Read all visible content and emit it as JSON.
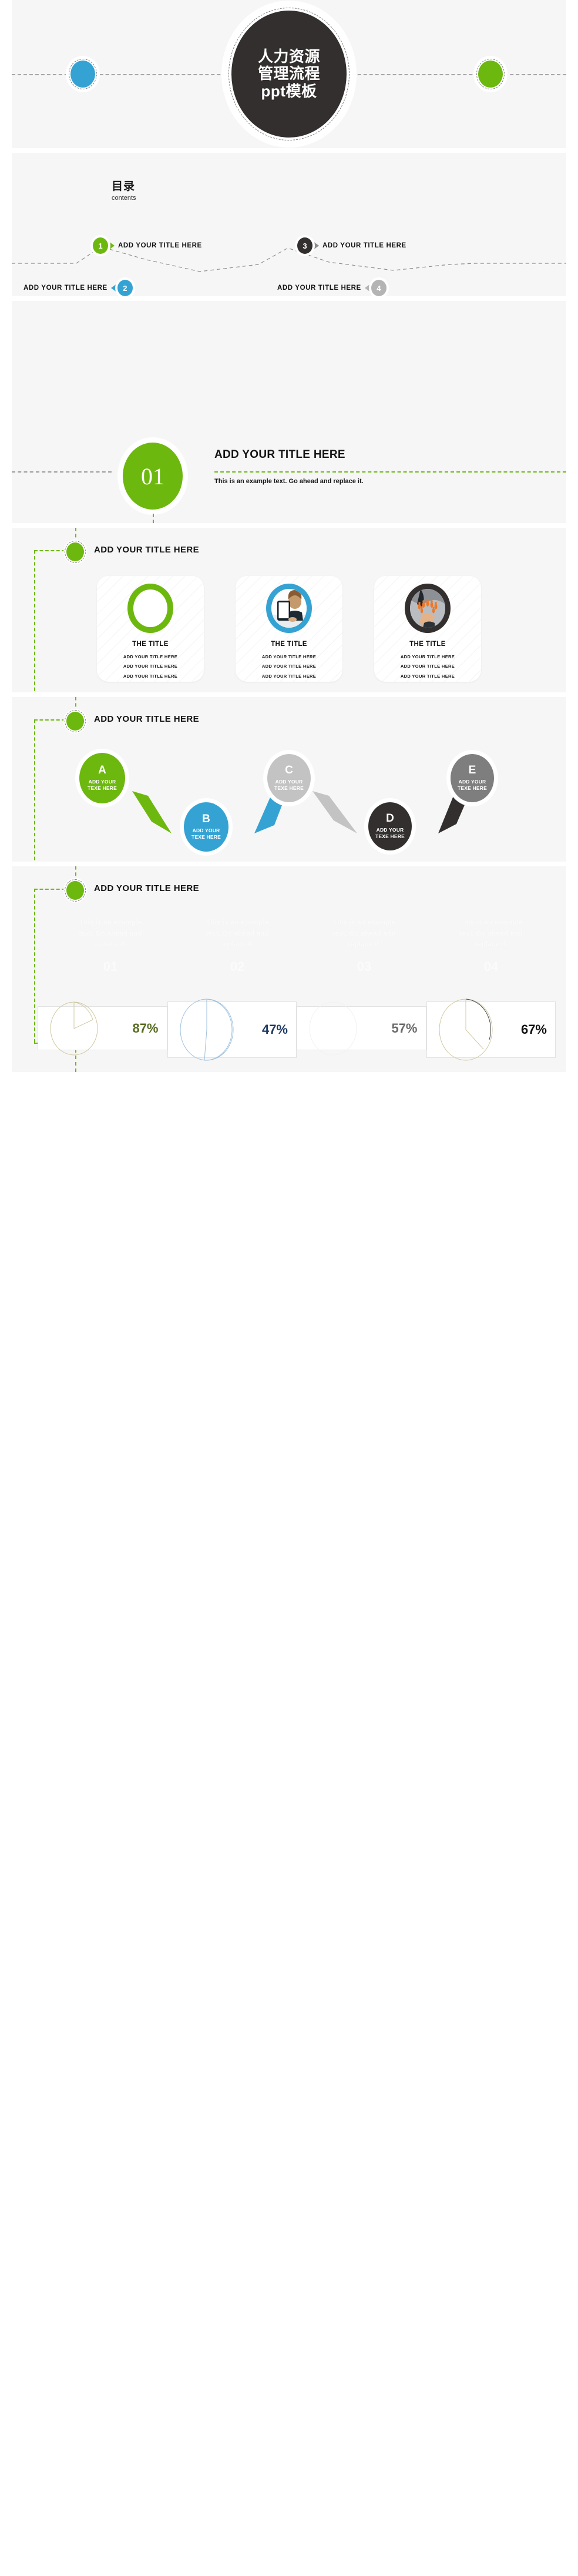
{
  "colors": {
    "green": "#6db80e",
    "blue": "#34a3d3",
    "dark": "#332f2e",
    "grey": "#c3c3c3",
    "grey_dark": "#7e7e7e",
    "page_bg": "#f6f6f6"
  },
  "slide1": {
    "name": "title-slide",
    "title_lines": [
      "人力资源",
      "管理流程",
      "ppt模板"
    ],
    "left_dot": "blue-dot",
    "right_dot": "green-dot"
  },
  "slide2": {
    "name": "contents-slide",
    "heading_cn": "目录",
    "heading_en": "contents",
    "items": [
      {
        "number": "1",
        "label": "ADD YOUR  TITLE HERE",
        "color": "#6db80e",
        "side": "right"
      },
      {
        "number": "2",
        "label": "ADD YOUR  TITLE HERE",
        "color": "#34a3d3",
        "side": "left"
      },
      {
        "number": "3",
        "label": "ADD YOUR  TITLE HERE",
        "color": "#332f2e",
        "side": "right"
      },
      {
        "number": "4",
        "label": "ADD YOUR  TITLE HERE",
        "color": "#b4b4b4",
        "side": "left"
      }
    ]
  },
  "slide3": {
    "name": "section-divider-slide",
    "number": "01",
    "title": "ADD YOUR TITLE HERE",
    "body": "This is an example text. Go ahead and replace it."
  },
  "slide4": {
    "name": "three-cards-slide",
    "title": "ADD YOUR  TITLE HERE",
    "cards": [
      {
        "image": "empty-circle-green",
        "title": "THE TITLE",
        "lines": [
          "ADD YOUR TITLE HERE",
          "ADD YOUR TITLE HERE",
          "ADD YOUR TITLE HERE"
        ]
      },
      {
        "image": "woman-with-tablet-photo",
        "title": "THE TITLE",
        "lines": [
          "ADD YOUR TITLE HERE",
          "ADD YOUR TITLE HERE",
          "ADD YOUR TITLE HERE"
        ]
      },
      {
        "image": "hand-with-orange-people-photo",
        "title": "THE TITLE",
        "lines": [
          "ADD YOUR TITLE HERE",
          "ADD YOUR TITLE HERE",
          "ADD YOUR TITLE HERE"
        ]
      }
    ]
  },
  "slide5": {
    "name": "abcde-flow-slide",
    "title": "ADD YOUR  TITLE HERE",
    "nodes": [
      {
        "letter": "A",
        "line1": "ADD YOUR",
        "line2": "TEXE HERE",
        "color": "#6db80e",
        "row": "top"
      },
      {
        "letter": "B",
        "line1": "ADD YOUR",
        "line2": "TEXE HERE",
        "color": "#34a3d3",
        "row": "bottom"
      },
      {
        "letter": "C",
        "line1": "ADD YOUR",
        "line2": "TEXE HERE",
        "color": "#c3c3c3",
        "row": "top"
      },
      {
        "letter": "D",
        "line1": "ADD YOUR",
        "line2": "TEXE HERE",
        "color": "#332f2e",
        "row": "bottom"
      },
      {
        "letter": "E",
        "line1": "ADD YOUR",
        "line2": "TEXE HERE",
        "color": "#7e7e7e",
        "row": "top"
      }
    ]
  },
  "slide6": {
    "name": "percent-charts-slide",
    "title": "ADD YOUR  TITLE HERE",
    "ghost_items": [
      {
        "text": "This is an example text. Go ahead and replace it.",
        "number": "01"
      },
      {
        "text": "This is an example text. Go ahead and replace it.",
        "number": "02"
      },
      {
        "text": "This is an example text. Go ahead and replace it.",
        "number": "03"
      },
      {
        "text": "This is an example text. Go ahead and replace it.",
        "number": "04"
      }
    ],
    "chart_data": {
      "type": "pie",
      "title": "",
      "categories": [
        "01",
        "02",
        "03",
        "04"
      ],
      "labels": [
        "87%",
        "47%",
        "57%",
        "67%"
      ],
      "values": [
        87,
        47,
        57,
        67
      ],
      "value_colors": [
        "#556b1f",
        "#1f3a63",
        "#6b6b6b",
        "#111111"
      ],
      "ring_colors": [
        "#cfc8a0",
        "#9dc0dd",
        "#d8d8d8",
        "#cfc8a0"
      ],
      "ylim": [
        0,
        100
      ],
      "grid": false,
      "legend": "none"
    }
  }
}
